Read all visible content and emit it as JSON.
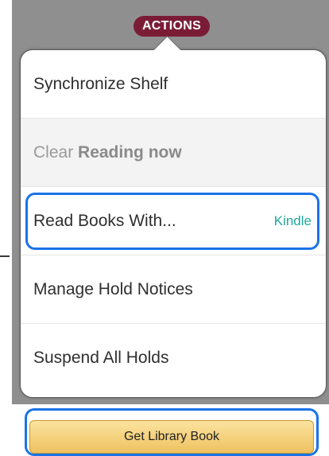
{
  "header": {
    "actions_label": "ACTIONS"
  },
  "menu": {
    "items": [
      {
        "label": "Synchronize Shelf",
        "enabled": true
      },
      {
        "label_prefix": "Clear ",
        "label_bold": "Reading now",
        "enabled": false
      },
      {
        "label": "Read Books With...",
        "value": "Kindle",
        "enabled": true
      },
      {
        "label": "Manage Hold Notices",
        "enabled": true
      },
      {
        "label": "Suspend All Holds",
        "enabled": true
      }
    ]
  },
  "footer": {
    "get_library_book_label": "Get Library Book"
  },
  "colors": {
    "actions_pill": "#7a1c36",
    "kindle_text": "#1fa89a",
    "highlight": "#1a73e8",
    "button_gradient_top": "#fbe39f",
    "button_gradient_bottom": "#efc160"
  }
}
